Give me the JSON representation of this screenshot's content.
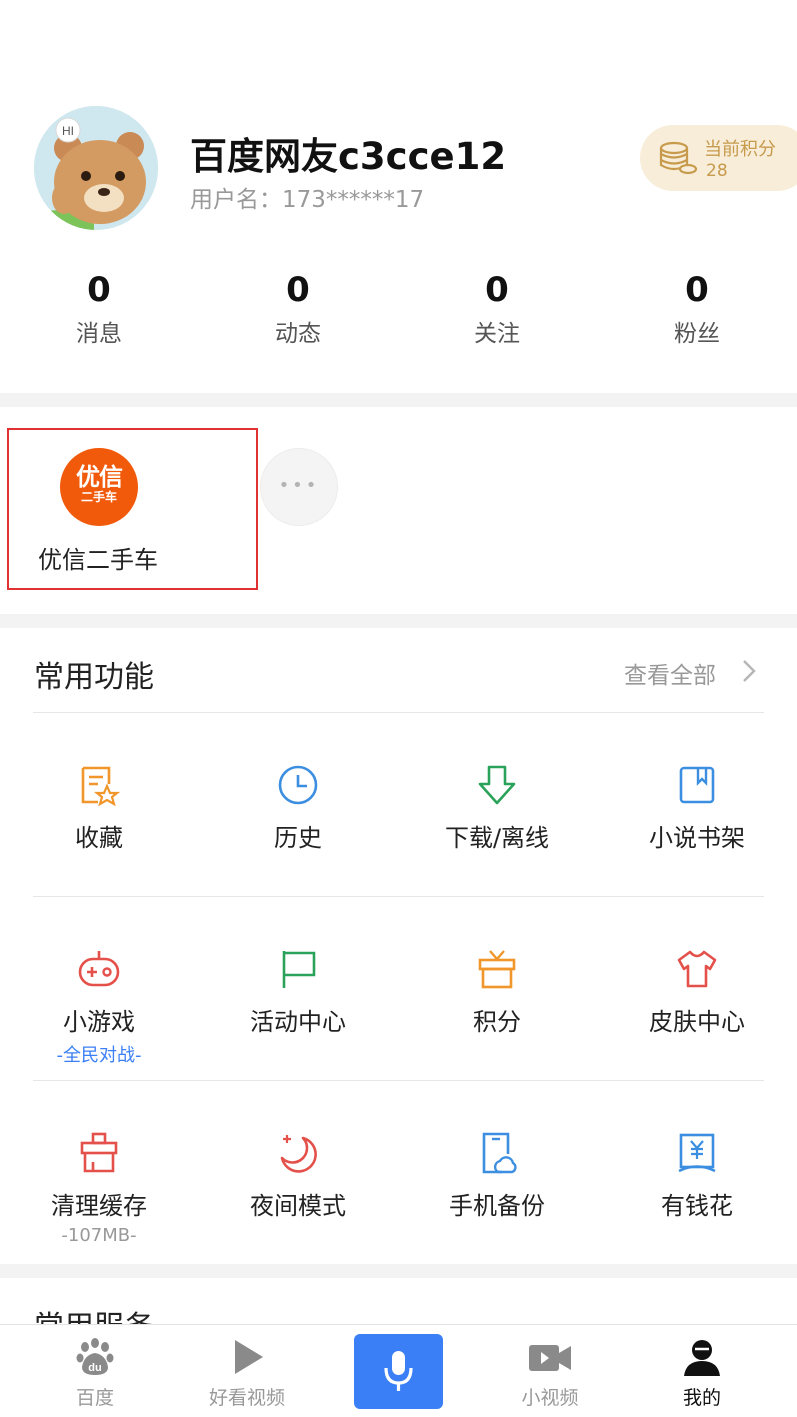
{
  "profile": {
    "nickname": "百度网友c3cce12",
    "username": "用户名：173******17",
    "avatar_greeting": "HI",
    "points_label": "当前积分",
    "points_value": "28"
  },
  "stats": [
    {
      "value": "0",
      "label": "消息"
    },
    {
      "value": "0",
      "label": "动态"
    },
    {
      "value": "0",
      "label": "关注"
    },
    {
      "value": "0",
      "label": "粉丝"
    }
  ],
  "mini_apps": {
    "items": [
      {
        "name": "优信二手车",
        "logo_line1": "优信",
        "logo_line2": "二手车",
        "logo_color": "#f25a0b"
      }
    ],
    "more_dots": "•••"
  },
  "features": {
    "title": "常用功能",
    "see_all": "查看全部",
    "items": [
      {
        "label": "收藏",
        "icon": "favorites-icon",
        "sub": ""
      },
      {
        "label": "历史",
        "icon": "clock-icon",
        "sub": ""
      },
      {
        "label": "下载/离线",
        "icon": "download-icon",
        "sub": ""
      },
      {
        "label": "小说书架",
        "icon": "bookshelf-icon",
        "sub": ""
      },
      {
        "label": "小游戏",
        "icon": "gamepad-icon",
        "sub": "-全民对战-"
      },
      {
        "label": "活动中心",
        "icon": "flag-icon",
        "sub": ""
      },
      {
        "label": "积分",
        "icon": "gift-icon",
        "sub": ""
      },
      {
        "label": "皮肤中心",
        "icon": "tshirt-icon",
        "sub": ""
      },
      {
        "label": "清理缓存",
        "icon": "broom-icon",
        "sub": "-107MB-"
      },
      {
        "label": "夜间模式",
        "icon": "moon-icon",
        "sub": ""
      },
      {
        "label": "手机备份",
        "icon": "phone-cloud-icon",
        "sub": ""
      },
      {
        "label": "有钱花",
        "icon": "money-book-icon",
        "sub": ""
      }
    ]
  },
  "services": {
    "title": "常用服务"
  },
  "tabbar": {
    "items": [
      {
        "label": "百度",
        "icon": "baidu-paw-icon"
      },
      {
        "label": "好看视频",
        "icon": "play-icon"
      },
      {
        "label": "",
        "icon": "microphone-icon"
      },
      {
        "label": "小视频",
        "icon": "video-camera-icon"
      },
      {
        "label": "我的",
        "icon": "user-icon"
      }
    ]
  },
  "colors": {
    "accent_blue": "#3a7ff6",
    "sub_blue": "#3a7ff6",
    "sub_gray": "#999999",
    "highlight_red": "#e03232",
    "icon_orange": "#f0962a",
    "icon_blue": "#3c8fe0",
    "icon_green": "#2ba25a",
    "icon_red": "#e4504a",
    "points_gold": "#c79a4c"
  }
}
